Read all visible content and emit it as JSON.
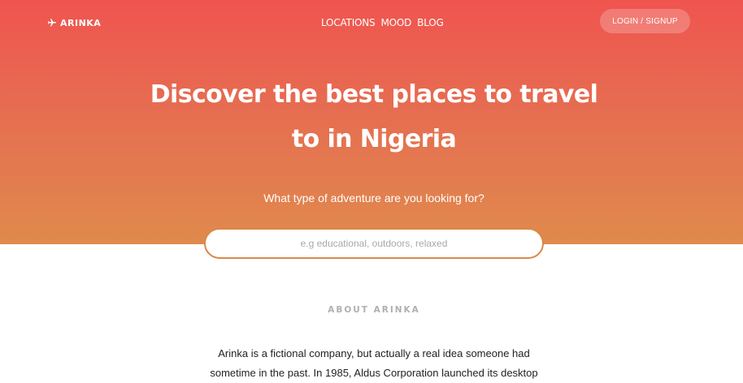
{
  "brand": {
    "name": "ARINKA",
    "icon": "airplane-icon"
  },
  "nav": {
    "items": [
      {
        "label": "LOCATIONS"
      },
      {
        "label": "MOOD"
      },
      {
        "label": "BLOG"
      }
    ],
    "login_label": "LOGIN / SIGNUP"
  },
  "hero": {
    "title_line1": "Discover the best places to travel",
    "title_line2": "to in Nigeria",
    "subtitle": "What type of adventure are you looking for?",
    "search_placeholder": "e.g educational, outdoors, relaxed",
    "search_value": ""
  },
  "about": {
    "heading": "ABOUT ARINKA",
    "line1": "Arinka is a fictional company, but actually a real idea someone had",
    "line2": "sometime in the past. In 1985, Aldus Corporation launched its desktop"
  },
  "colors": {
    "hero_top": "#f0544f",
    "hero_bottom": "#e08a4c",
    "search_border": "#d9894a"
  }
}
